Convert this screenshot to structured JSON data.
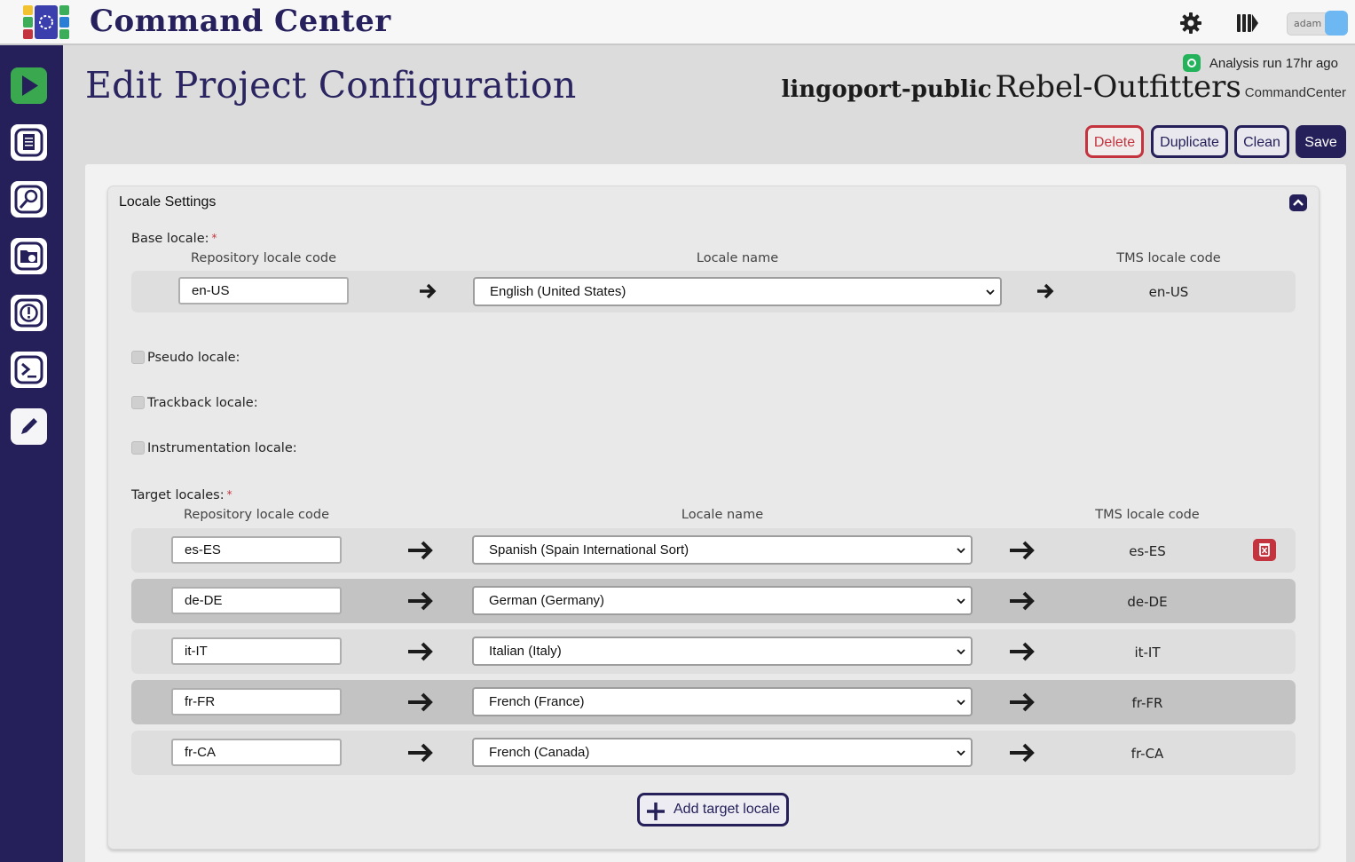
{
  "app": {
    "title": "Command Center"
  },
  "user": {
    "name": "adam"
  },
  "page": {
    "title": "Edit Project Configuration"
  },
  "status": {
    "analysis": "Analysis run 17hr ago"
  },
  "project": {
    "org": "lingoport-public",
    "name": "Rebel-Outfitters",
    "group": "CommandCenter"
  },
  "actions": {
    "delete": "Delete",
    "duplicate": "Duplicate",
    "clean": "Clean",
    "save": "Save"
  },
  "locale_settings": {
    "title": "Locale Settings",
    "base_label": "Base locale:",
    "required_mark": "*",
    "col_repo": "Repository locale code",
    "col_name": "Locale name",
    "col_tms": "TMS locale code",
    "base": {
      "repo": "en-US",
      "name": "English (United States)",
      "tms": "en-US"
    },
    "pseudo_label": "Pseudo locale:",
    "trackback_label": "Trackback locale:",
    "instrumentation_label": "Instrumentation locale:",
    "target_label": "Target locales:",
    "targets": [
      {
        "repo": "es-ES",
        "name": "Spanish (Spain International Sort)",
        "tms": "es-ES"
      },
      {
        "repo": "de-DE",
        "name": "German (Germany)",
        "tms": "de-DE"
      },
      {
        "repo": "it-IT",
        "name": "Italian (Italy)",
        "tms": "it-IT"
      },
      {
        "repo": "fr-FR",
        "name": "French (France)",
        "tms": "fr-FR"
      },
      {
        "repo": "fr-CA",
        "name": "French (Canada)",
        "tms": "fr-CA"
      }
    ],
    "add_target": "Add target locale"
  },
  "colors": {
    "brand": "#25205a",
    "danger": "#c3343e",
    "success": "#24b35a"
  }
}
